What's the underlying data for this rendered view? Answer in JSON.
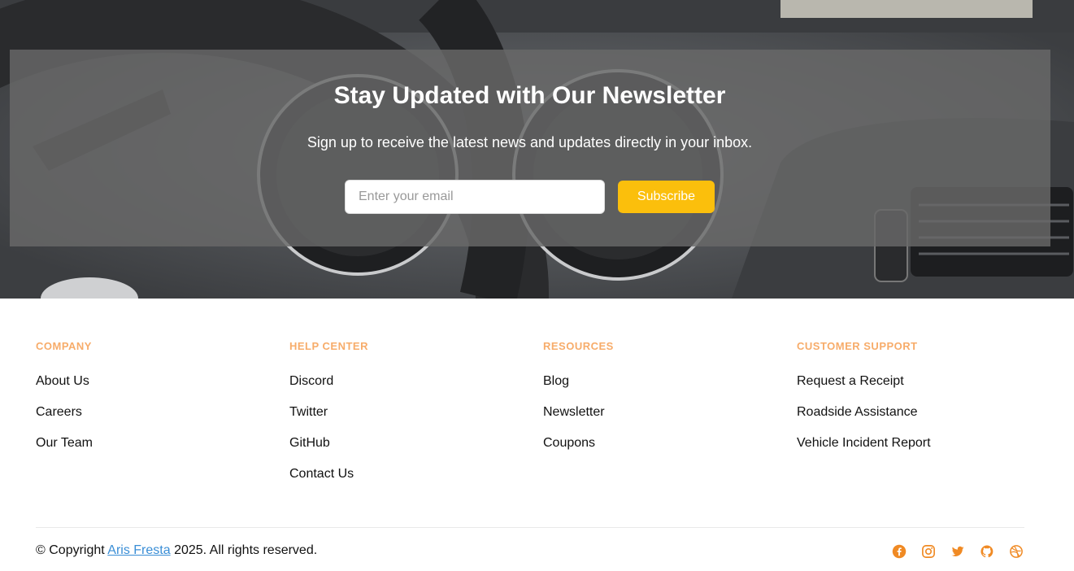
{
  "newsletter": {
    "title": "Stay Updated with Our Newsletter",
    "subtitle": "Sign up to receive the latest news and updates directly in your inbox.",
    "email_placeholder": "Enter your email",
    "email_value": "",
    "subscribe_label": "Subscribe"
  },
  "footer": {
    "columns": [
      {
        "heading": "COMPANY",
        "links": [
          "About Us",
          "Careers",
          "Our Team"
        ]
      },
      {
        "heading": "HELP CENTER",
        "links": [
          "Discord",
          "Twitter",
          "GitHub",
          "Contact Us"
        ]
      },
      {
        "heading": "RESOURCES",
        "links": [
          "Blog",
          "Newsletter",
          "Coupons"
        ]
      },
      {
        "heading": "CUSTOMER SUPPORT",
        "links": [
          "Request a Receipt",
          "Roadside Assistance",
          "Vehicle Incident Report"
        ]
      }
    ],
    "copyright": {
      "prefix": "© Copyright ",
      "author": "Aris Fresta",
      "suffix": " 2025. All rights reserved."
    },
    "social_icons": [
      "facebook-icon",
      "instagram-icon",
      "twitter-icon",
      "github-icon",
      "dribbble-icon"
    ]
  },
  "colors": {
    "accent": "#fbbf0c",
    "heading": "#f7ac6a",
    "social": "#f08a24",
    "link": "#3a8ed6"
  }
}
